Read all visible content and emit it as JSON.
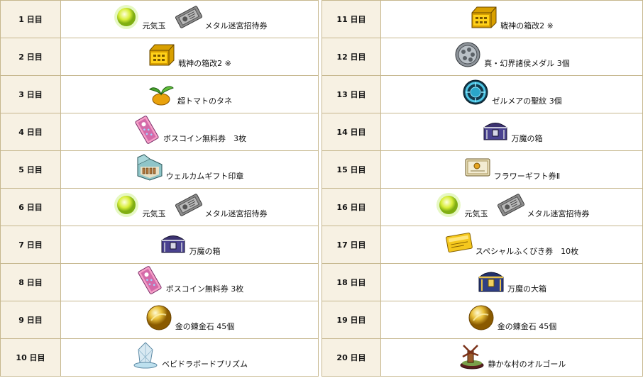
{
  "left_rows": [
    {
      "day": "1 日目",
      "items": [
        {
          "icon": "genki-orb-icon",
          "label": "元気玉"
        },
        {
          "icon": "metal-ticket-icon",
          "label": "メタル迷宮招待券"
        }
      ]
    },
    {
      "day": "2 日目",
      "items": [
        {
          "icon": "gold-box-icon",
          "label": "戦神の箱改2 ※"
        }
      ]
    },
    {
      "day": "3 日目",
      "items": [
        {
          "icon": "tomato-seed-icon",
          "label": "超トマトのタネ"
        }
      ]
    },
    {
      "day": "4 日目",
      "items": [
        {
          "icon": "boss-coin-ticket-icon",
          "label": "ボスコイン無料券　3枚"
        }
      ]
    },
    {
      "day": "5 日目",
      "items": [
        {
          "icon": "gift-stamp-box-icon",
          "label": "ウェルカムギフト印章"
        }
      ]
    },
    {
      "day": "6 日目",
      "items": [
        {
          "icon": "genki-orb-icon",
          "label": "元気玉"
        },
        {
          "icon": "metal-ticket-icon",
          "label": "メタル迷宮招待券"
        }
      ]
    },
    {
      "day": "7 日目",
      "items": [
        {
          "icon": "dark-chest-icon",
          "label": "万魔の箱"
        }
      ]
    },
    {
      "day": "8 日目",
      "items": [
        {
          "icon": "boss-coin-ticket-icon",
          "label": "ボスコイン無料券 3枚"
        }
      ]
    },
    {
      "day": "9 日目",
      "items": [
        {
          "icon": "gold-stone-icon",
          "label": "金の錬金石 45個"
        }
      ]
    },
    {
      "day": "10 日目",
      "items": [
        {
          "icon": "prism-icon",
          "label": "ベビドラボードプリズム"
        }
      ]
    }
  ],
  "right_rows": [
    {
      "day": "11 日目",
      "items": [
        {
          "icon": "gold-box-icon",
          "label": "戦神の箱改2 ※"
        }
      ]
    },
    {
      "day": "12 日目",
      "items": [
        {
          "icon": "hero-medal-icon",
          "label": "真・幻界諸侯メダル 3個"
        }
      ]
    },
    {
      "day": "13 日目",
      "items": [
        {
          "icon": "blue-crest-icon",
          "label": "ゼルメアの聖紋 3個"
        }
      ]
    },
    {
      "day": "14 日目",
      "items": [
        {
          "icon": "dark-chest-icon",
          "label": "万魔の箱"
        }
      ]
    },
    {
      "day": "15 日目",
      "items": [
        {
          "icon": "flower-gift-ticket-icon",
          "label": "フラワーギフト券Ⅱ"
        }
      ]
    },
    {
      "day": "16 日目",
      "items": [
        {
          "icon": "genki-orb-icon",
          "label": "元気玉"
        },
        {
          "icon": "metal-ticket-icon",
          "label": "メタル迷宮招待券"
        }
      ]
    },
    {
      "day": "17 日目",
      "items": [
        {
          "icon": "lottery-ticket-icon",
          "label": "スペシャルふくびき券　10枚"
        }
      ]
    },
    {
      "day": "18 日目",
      "items": [
        {
          "icon": "big-dark-chest-icon",
          "label": "万魔の大箱"
        }
      ]
    },
    {
      "day": "19 日目",
      "items": [
        {
          "icon": "gold-stone-icon",
          "label": "金の錬金石 45個"
        }
      ]
    },
    {
      "day": "20 日目",
      "items": [
        {
          "icon": "music-box-icon",
          "label": "静かな村のオルゴール"
        }
      ]
    }
  ]
}
